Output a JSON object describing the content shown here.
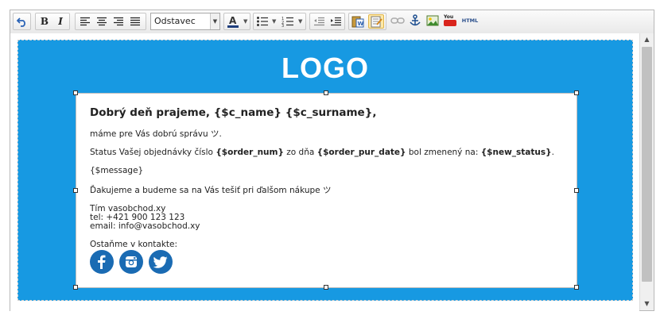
{
  "toolbar": {
    "format_select": "Odstavec",
    "html_button": "HTML",
    "youtube_button": "You"
  },
  "email": {
    "logo": "LOGO",
    "greeting": "Dobrý deň prajeme, {$c_name} {$c_surname},",
    "intro": "máme pre Vás dobrú správu ツ.",
    "status": {
      "t1": "Status Vašej objednávky číslo ",
      "v1": "{$order_num}",
      "t2": " zo dňa ",
      "v2": "{$order_pur_date}",
      "t3": " bol zmenený na: ",
      "v3": "{$new_status}",
      "t4": "."
    },
    "message": "{$message}",
    "thanks": "Ďakujeme a budeme sa na Vás tešiť pri ďalšom nákupe ツ",
    "signature": [
      "Tím vasobchod.xy",
      "tel: +421 900 123 123",
      "email: info@vasobchod.xy"
    ],
    "contact_label": "Ostaňme v kontakte:",
    "social_icons": [
      "facebook-icon",
      "instagram-icon",
      "twitter-icon"
    ]
  },
  "colors": {
    "header_bg": "#1799e2",
    "social_circle": "#1a6bb3"
  }
}
